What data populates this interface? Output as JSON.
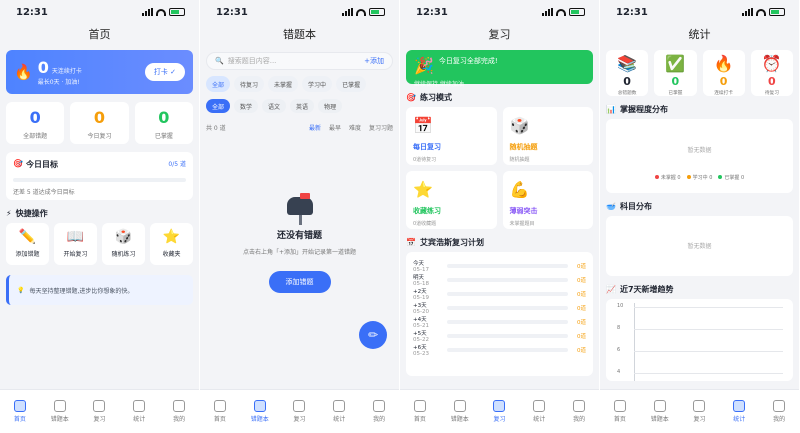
{
  "status": {
    "time": "12:31"
  },
  "home": {
    "title": "首页",
    "streak": "0",
    "streak_label": "天连续打卡",
    "hero_sub": "最长0天 · 加油!",
    "checkin": "打卡 ✓",
    "stats": [
      {
        "value": "0",
        "label": "全部错题"
      },
      {
        "value": "0",
        "label": "今日复习"
      },
      {
        "value": "0",
        "label": "已掌握"
      }
    ],
    "goal_title": "今日目标",
    "goal_value": "0/5 道",
    "goal_hint": "还差 5 道达成今日目标",
    "quick_title": "快捷操作",
    "actions": [
      {
        "icon": "✏️",
        "label": "添加错题"
      },
      {
        "icon": "📖",
        "label": "开始复习"
      },
      {
        "icon": "🎲",
        "label": "随机练习"
      },
      {
        "icon": "⭐",
        "label": "收藏夹"
      }
    ],
    "tip": "每天坚持整理错题,进步比你想象的快。"
  },
  "errors": {
    "title": "错题本",
    "search_placeholder": "搜索题目内容...",
    "add_link": "+添加",
    "chips": [
      "全部",
      "待复习",
      "未掌握",
      "学习中",
      "已掌握"
    ],
    "subjects": [
      "全部",
      "数学",
      "语文",
      "英语",
      "物理"
    ],
    "count": "共 0 道",
    "sorts": [
      "最新",
      "最早",
      "难度",
      "复习习题"
    ],
    "empty_title": "还没有错题",
    "empty_sub": "点击右上角「+添加」开始记录第一道错题",
    "add_button": "添加错题",
    "fab": "✏"
  },
  "review": {
    "title": "复习",
    "banner_title": "今日复习全部完成!",
    "banner_sub": "继续保持,继续加油",
    "mode_title": "练习模式",
    "modes": [
      {
        "icon": "📅",
        "title": "每日复习",
        "sub": "0道待复习"
      },
      {
        "icon": "🎲",
        "title": "随机抽题",
        "sub": "随机抽题"
      },
      {
        "icon": "⭐",
        "title": "收藏练习",
        "sub": "0道收藏题"
      },
      {
        "icon": "💪",
        "title": "薄弱突击",
        "sub": "未掌握题目"
      }
    ],
    "plan_title": "艾宾浩斯复习计划",
    "plan": [
      {
        "day": "今天",
        "date": "05-17",
        "value": "0道"
      },
      {
        "day": "明天",
        "date": "05-18",
        "value": "0道"
      },
      {
        "day": "+2天",
        "date": "05-19",
        "value": "0道"
      },
      {
        "day": "+3天",
        "date": "05-20",
        "value": "0道"
      },
      {
        "day": "+4天",
        "date": "05-21",
        "value": "0道"
      },
      {
        "day": "+5天",
        "date": "05-22",
        "value": "0道"
      },
      {
        "day": "+6天",
        "date": "05-23",
        "value": "0道"
      }
    ]
  },
  "stats": {
    "title": "统计",
    "top": [
      {
        "icon": "📚",
        "value": "0",
        "label": "总错题数"
      },
      {
        "icon": "✅",
        "value": "0",
        "label": "已掌握"
      },
      {
        "icon": "🔥",
        "value": "0",
        "label": "连续打卡"
      },
      {
        "icon": "⏰",
        "value": "0",
        "label": "待复习"
      }
    ],
    "mastery_title": "掌握程度分布",
    "no_data": "暂无数据",
    "legend": [
      "未掌握 0",
      "学习中 0",
      "已掌握 0"
    ],
    "subject_title": "科目分布",
    "trend_title": "近7天新增趋势",
    "ticks": [
      "10",
      "8",
      "6",
      "4"
    ]
  },
  "tabs": [
    "首页",
    "错题本",
    "复习",
    "统计",
    "我的"
  ]
}
